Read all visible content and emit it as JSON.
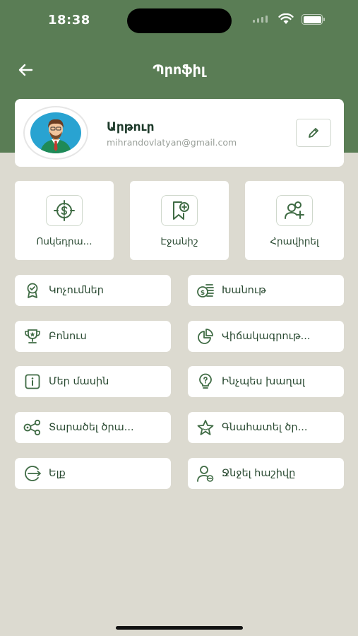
{
  "status": {
    "time": "18:38"
  },
  "header": {
    "title": "Պրոֆիլ"
  },
  "profile": {
    "name": "Արթուր",
    "email": "mihrandovlatyan@gmail.com"
  },
  "tiles": [
    {
      "label": "Ոսկեդրա...",
      "icon": "dollar-target-icon"
    },
    {
      "label": "Էջանիշ",
      "icon": "bookmark-add-icon"
    },
    {
      "label": "Հրավիրել",
      "icon": "invite-user-icon"
    }
  ],
  "menu": {
    "achievements": "Կոչումներ",
    "shop": "Խանութ",
    "bonus": "Բոնուս",
    "statistics": "Վիճակագրութ...",
    "about": "Մեր մասին",
    "how_to_play": "Ինչպես խաղալ",
    "share": "Տարածել ծրա...",
    "rate": "Գնահատել ծր...",
    "logout": "Ելք",
    "delete_account": "Ջնջել հաշիվը"
  },
  "colors": {
    "accent": "#5a7d55",
    "background": "#dcdad0",
    "icon": "#3f6b44"
  }
}
